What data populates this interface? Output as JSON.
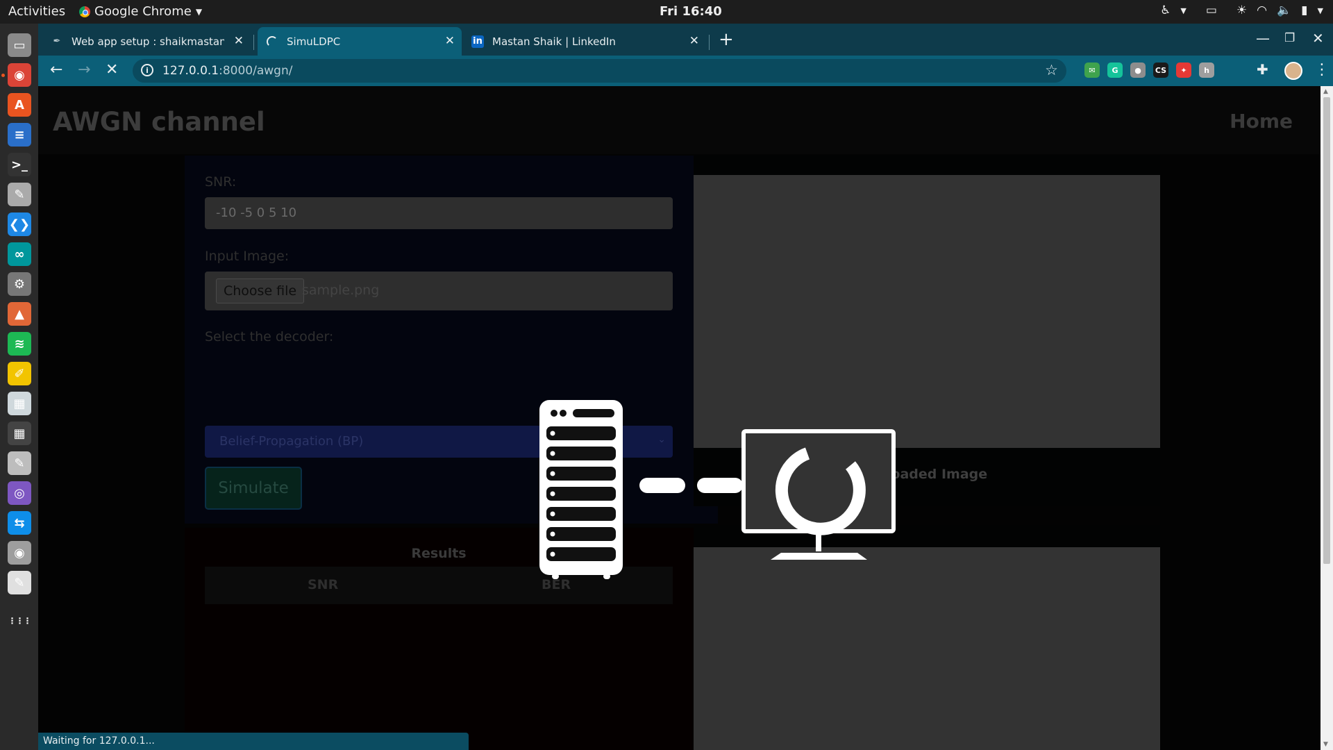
{
  "topbar": {
    "activities": "Activities",
    "app_name": "Google Chrome",
    "clock": "Fri 16:40"
  },
  "dock": {
    "items": [
      {
        "icon": "files-icon",
        "color": "#8a8a8a"
      },
      {
        "icon": "chrome-icon",
        "color": "#db4437",
        "active": true
      },
      {
        "icon": "software-center-icon",
        "color": "#e95420"
      },
      {
        "icon": "writer-icon",
        "color": "#2a6fc9"
      },
      {
        "icon": "terminal-icon",
        "color": "#333333"
      },
      {
        "icon": "inkscape-icon",
        "color": "#aaaaaa"
      },
      {
        "icon": "vscode-icon",
        "color": "#1e88e5"
      },
      {
        "icon": "arduino-icon",
        "color": "#00979c"
      },
      {
        "icon": "settings-icon",
        "color": "#777777"
      },
      {
        "icon": "matlab-icon",
        "color": "#e16737"
      },
      {
        "icon": "spotify-icon",
        "color": "#1db954"
      },
      {
        "icon": "notes-icon",
        "color": "#f2c400"
      },
      {
        "icon": "sheets-icon",
        "color": "#cfd8dc"
      },
      {
        "icon": "calculator-icon",
        "color": "#444444"
      },
      {
        "icon": "drawing-icon",
        "color": "#bdbdbd"
      },
      {
        "icon": "screenshot-icon",
        "color": "#7e57c2"
      },
      {
        "icon": "teamviewer-icon",
        "color": "#0e8ee9"
      },
      {
        "icon": "vpn-icon",
        "color": "#9e9e9e"
      },
      {
        "icon": "text-editor-icon",
        "color": "#e0e0e0"
      },
      {
        "icon": "show-apps-icon",
        "color": "#2a2a2a"
      }
    ],
    "show_apps_glyph": "⋮⋮⋮"
  },
  "tabs": [
    {
      "title": "Web app setup : shaikmastan : P",
      "favicon": "feather-icon",
      "active": false
    },
    {
      "title": "SimuLDPC",
      "favicon": "loading-spinner-icon",
      "active": true
    },
    {
      "title": "Mastan Shaik | LinkedIn",
      "favicon": "linkedin-icon",
      "active": false
    }
  ],
  "linkedin_glyph": "in",
  "omnibox": {
    "host": "127.0.0.1",
    "path": ":8000/awgn/"
  },
  "extensions": [
    {
      "icon": "mail-extension-icon",
      "glyph": "✉",
      "color": "#3fa34d"
    },
    {
      "icon": "grammarly-icon",
      "glyph": "G",
      "color": "#15c39a"
    },
    {
      "icon": "location-extension-icon",
      "glyph": "●",
      "color": "#8d8d8d"
    },
    {
      "icon": "cs-extension-icon",
      "glyph": "CS",
      "color": "#1a1a1a"
    },
    {
      "icon": "color-extension-icon",
      "glyph": "✦",
      "color": "#e53935"
    },
    {
      "icon": "text-extension-icon",
      "glyph": "h",
      "color": "#9e9e9e"
    }
  ],
  "page": {
    "brand": "AWGN channel",
    "nav_home": "Home",
    "snr_label": "SNR:",
    "snr_value": "-10 -5 0 5 10",
    "image_label": "Input Image:",
    "choose_file": "Choose file",
    "file_name": "sample.png",
    "decoder_label": "Select the decoder:",
    "decoder_value": "Belief-Propagation (BP)",
    "simulate": "Simulate",
    "results_title": "Results",
    "results_columns": [
      "SNR",
      "BER"
    ],
    "uploaded_caption": "Uploaded Image"
  },
  "status": "Waiting for 127.0.0.1..."
}
